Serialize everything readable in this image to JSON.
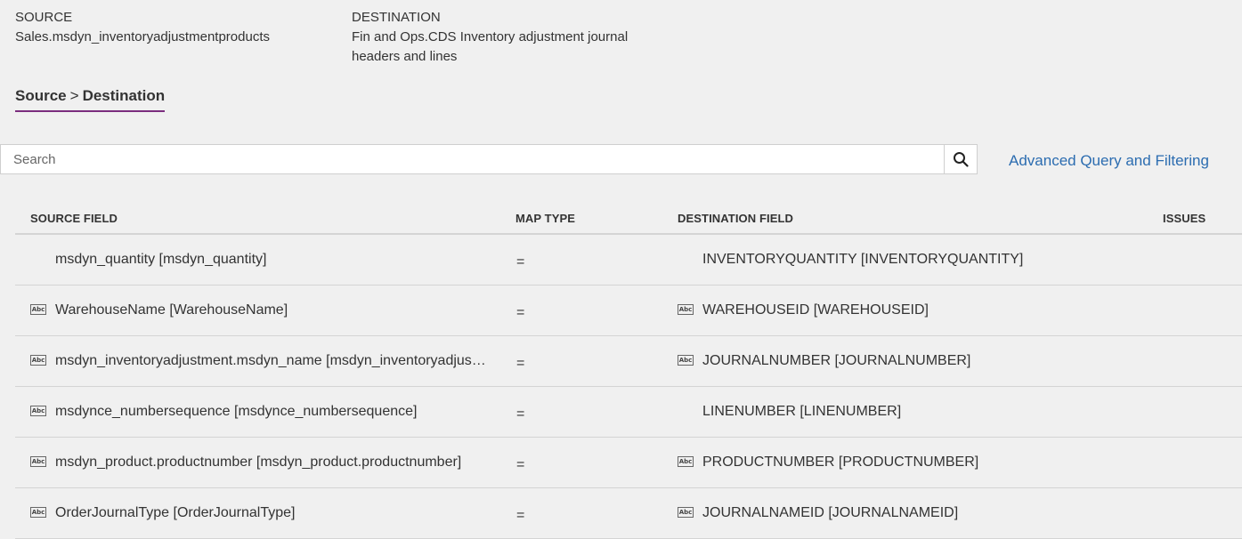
{
  "header": {
    "source_label": "SOURCE",
    "source_value": "Sales.msdyn_inventoryadjustmentproducts",
    "destination_label": "DESTINATION",
    "destination_value": "Fin and Ops.CDS Inventory adjustment journal headers and lines"
  },
  "pivot": {
    "source": "Source",
    "separator": ">",
    "destination": "Destination"
  },
  "search": {
    "placeholder": "Search",
    "value": ""
  },
  "advanced_link": "Advanced Query and Filtering",
  "columns": {
    "source": "SOURCE FIELD",
    "map": "MAP TYPE",
    "destination": "DESTINATION FIELD",
    "issues": "ISSUES"
  },
  "rows": [
    {
      "source": "msdyn_quantity [msdyn_quantity]",
      "map": "=",
      "destination": "INVENTORYQUANTITY [INVENTORYQUANTITY]",
      "src_icon": "",
      "dst_icon": ""
    },
    {
      "source": "WarehouseName [WarehouseName]",
      "map": "=",
      "destination": "WAREHOUSEID [WAREHOUSEID]",
      "src_icon": "Abc",
      "dst_icon": "Abc"
    },
    {
      "source": "msdyn_inventoryadjustment.msdyn_name [msdyn_inventoryadjustment.msdyn_name]",
      "map": "=",
      "destination": "JOURNALNUMBER [JOURNALNUMBER]",
      "src_icon": "Abc",
      "dst_icon": "Abc"
    },
    {
      "source": "msdynce_numbersequence [msdynce_numbersequence]",
      "map": "=",
      "destination": "LINENUMBER [LINENUMBER]",
      "src_icon": "Abc",
      "dst_icon": ""
    },
    {
      "source": "msdyn_product.productnumber [msdyn_product.productnumber]",
      "map": "=",
      "destination": "PRODUCTNUMBER [PRODUCTNUMBER]",
      "src_icon": "Abc",
      "dst_icon": "Abc"
    },
    {
      "source": "OrderJournalType [OrderJournalType]",
      "map": "=",
      "destination": "JOURNALNAMEID [JOURNALNAMEID]",
      "src_icon": "Abc",
      "dst_icon": "Abc"
    }
  ]
}
